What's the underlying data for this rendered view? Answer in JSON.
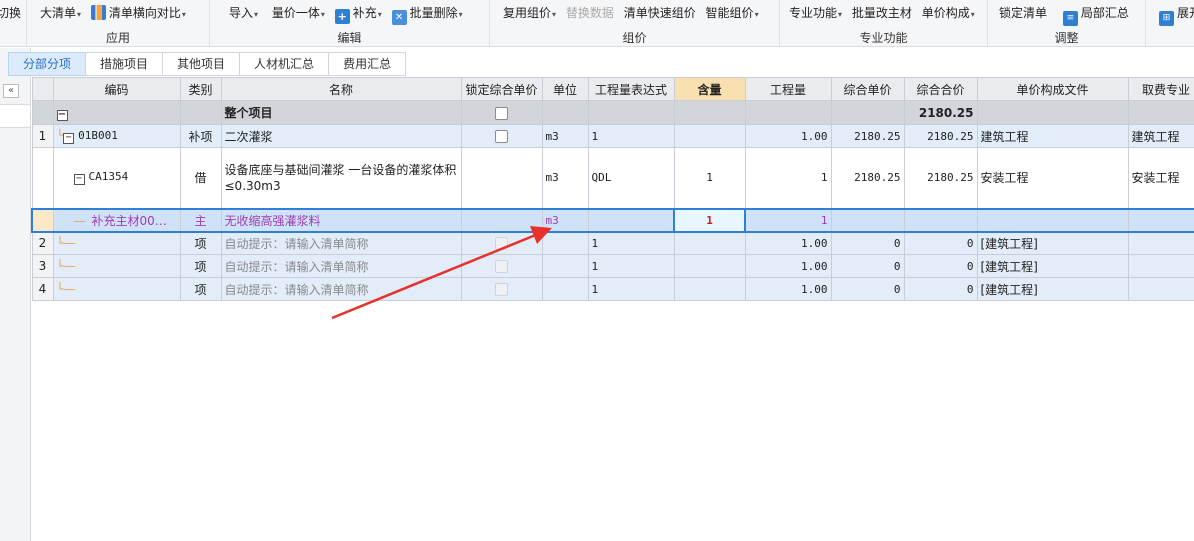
{
  "ribbon": {
    "groups": [
      {
        "buttons": [
          {
            "label": "切换"
          }
        ],
        "label": ""
      },
      {
        "buttons": [
          {
            "label": "大清单",
            "caret": true
          },
          {
            "label": "清单横向对比",
            "caret": true,
            "icon": "columns-compare-icon"
          }
        ],
        "label": "应用"
      },
      {
        "buttons": [
          {
            "label": "导入",
            "caret": true
          },
          {
            "label": "量价一体",
            "caret": true
          },
          {
            "label": "补充",
            "caret": true,
            "icon": "add-supplement-icon"
          },
          {
            "label": "批量删除",
            "caret": true,
            "icon": "batch-delete-icon"
          }
        ],
        "label": "编辑"
      },
      {
        "buttons": [
          {
            "label": "复用组价",
            "caret": true
          },
          {
            "label": "替换数据",
            "disabled": true
          },
          {
            "label": "清单快速组价"
          },
          {
            "label": "智能组价",
            "caret": true
          }
        ],
        "label": "组价"
      },
      {
        "buttons": [
          {
            "label": "专业功能",
            "caret": true
          },
          {
            "label": "批量改主材"
          },
          {
            "label": "单价构成",
            "caret": true
          }
        ],
        "label": "专业功能"
      },
      {
        "buttons": [
          {
            "label": "锁定清单"
          },
          {
            "label": "局部汇总",
            "icon": "partial-summary-icon"
          }
        ],
        "label": "调整"
      },
      {
        "buttons": [
          {
            "label": "展开",
            "icon": "expand-tree-icon"
          }
        ],
        "label": ""
      }
    ]
  },
  "tabs": [
    "分部分项",
    "措施项目",
    "其他项目",
    "人材机汇总",
    "费用汇总"
  ],
  "active_tab": "分部分项",
  "table": {
    "headers": [
      "编码",
      "类别",
      "名称",
      "锁定综合单价",
      "单位",
      "工程量表达式",
      "含量",
      "工程量",
      "综合单价",
      "综合合价",
      "单价构成文件",
      "取费专业"
    ],
    "total_row": {
      "name": "整个项目",
      "total_price": "2180.25"
    },
    "rows": [
      {
        "no": "1",
        "code": "01B001",
        "type": "补项",
        "name": "二次灌浆",
        "unit": "m3",
        "expr": "1",
        "content": "",
        "qty": "1.00",
        "unit_price": "2180.25",
        "total_price": "2180.25",
        "pricing_file": "建筑工程",
        "fee_major": "建筑工程"
      },
      {
        "no": "",
        "code": "CA1354",
        "type": "借",
        "name": "设备底座与基础间灌浆 一台设备的灌浆体积≤0.30m3",
        "unit": "m3",
        "expr": "QDL",
        "content": "1",
        "qty": "1",
        "unit_price": "2180.25",
        "total_price": "2180.25",
        "pricing_file": "安装工程",
        "fee_major": "安装工程"
      },
      {
        "no": "",
        "code": "补充主材00…",
        "type": "主",
        "name": "无收缩高强灌浆料",
        "unit": "m3",
        "expr": "",
        "content": "1",
        "qty": "1",
        "unit_price": "",
        "total_price": "",
        "pricing_file": "",
        "fee_major": ""
      },
      {
        "no": "2",
        "code": "",
        "type": "项",
        "name": "自动提示：请输入清单简称",
        "unit": "",
        "expr": "1",
        "content": "",
        "qty": "1.00",
        "unit_price": "0",
        "total_price": "0",
        "pricing_file": "[建筑工程]",
        "fee_major": ""
      },
      {
        "no": "3",
        "code": "",
        "type": "项",
        "name": "自动提示：请输入清单简称",
        "unit": "",
        "expr": "1",
        "content": "",
        "qty": "1.00",
        "unit_price": "0",
        "total_price": "0",
        "pricing_file": "[建筑工程]",
        "fee_major": ""
      },
      {
        "no": "4",
        "code": "",
        "type": "项",
        "name": "自动提示：请输入清单简称",
        "unit": "",
        "expr": "1",
        "content": "",
        "qty": "1.00",
        "unit_price": "0",
        "total_price": "0",
        "pricing_file": "[建筑工程]",
        "fee_major": ""
      }
    ]
  },
  "colors": {
    "selection_border": "#2f7fd8",
    "annotation_arrow": "#e8312a",
    "highlight_header": "#f8dfb0"
  }
}
